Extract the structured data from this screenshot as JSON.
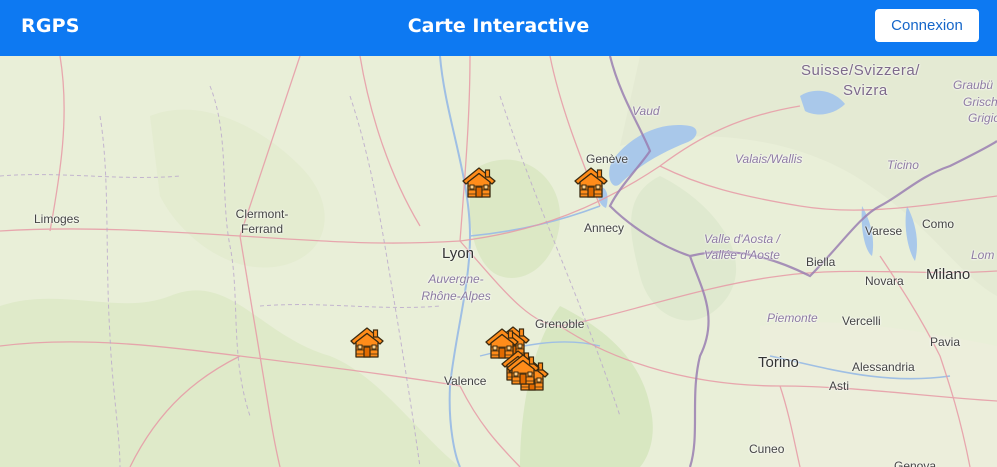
{
  "header": {
    "brand": "RGPS",
    "title": "Carte Interactive",
    "login_label": "Connexion"
  },
  "colors": {
    "header_bg": "#0d79f2",
    "marker": "#ff8c1a"
  },
  "map": {
    "labels": {
      "limoges": "Limoges",
      "clermont_1": "Clermont-",
      "clermont_2": "Ferrand",
      "lyon": "Lyon",
      "auvergne_1": "Auvergne-",
      "auvergne_2": "Rhône-Alpes",
      "valence": "Valence",
      "grenoble": "Grenoble",
      "annecy": "Annecy",
      "geneve": "Genève",
      "vaud": "Vaud",
      "valais": "Valais/Wallis",
      "suisse_1": "Suisse/Svizzera/",
      "suisse_2": "Svizra",
      "graubu_1": "Graubü",
      "graubu_2": "Grisch",
      "graubu_3": "Grigio",
      "ticino": "Ticino",
      "varese": "Varese",
      "como": "Como",
      "aosta_1": "Valle d'Aosta /",
      "aosta_2": "Vallée d'Aoste",
      "biella": "Biella",
      "novara": "Novara",
      "milano": "Milano",
      "lom": "Lom",
      "piemonte": "Piemonte",
      "vercelli": "Vercelli",
      "pavia": "Pavia",
      "torino": "Torino",
      "alessandria": "Alessandria",
      "asti": "Asti",
      "cuneo": "Cuneo",
      "genova": "Genova"
    },
    "markers": [
      {
        "name": "house-marker-1",
        "icon": "house-icon"
      },
      {
        "name": "house-marker-2",
        "icon": "house-icon"
      },
      {
        "name": "house-marker-3",
        "icon": "house-icon"
      },
      {
        "name": "house-marker-4",
        "icon": "house-icon"
      },
      {
        "name": "house-marker-5",
        "icon": "house-icon"
      },
      {
        "name": "house-marker-6",
        "icon": "house-icon"
      },
      {
        "name": "house-marker-7",
        "icon": "house-icon"
      },
      {
        "name": "house-marker-8",
        "icon": "house-icon"
      }
    ]
  }
}
